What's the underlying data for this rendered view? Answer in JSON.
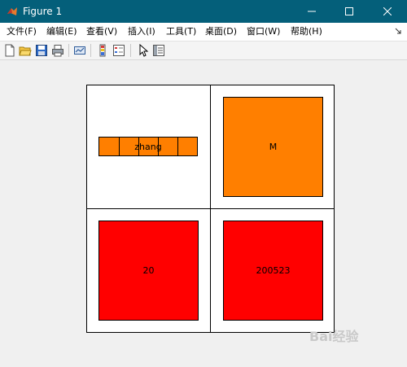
{
  "window": {
    "title": "Figure 1"
  },
  "menu": [
    "文件(F)",
    "编辑(E)",
    "查看(V)",
    "插入(I)",
    "工具(T)",
    "桌面(D)",
    "窗口(W)",
    "帮助(H)"
  ],
  "toolbar_icons": [
    "new-figure-icon",
    "open-file-icon",
    "save-icon",
    "print-icon",
    "link-plot-icon",
    "colorbar-icon",
    "legend-icon",
    "select-arrow-icon",
    "property-inspector-icon"
  ],
  "panels": {
    "name_label": "zhang",
    "gender_label": "M",
    "age_label": "20",
    "id_label": "200523"
  },
  "colors": {
    "orange": "#ff7f00",
    "red": "#ff0000",
    "titlebar": "#045f7a"
  },
  "watermark": {
    "text": "Bai经验"
  }
}
